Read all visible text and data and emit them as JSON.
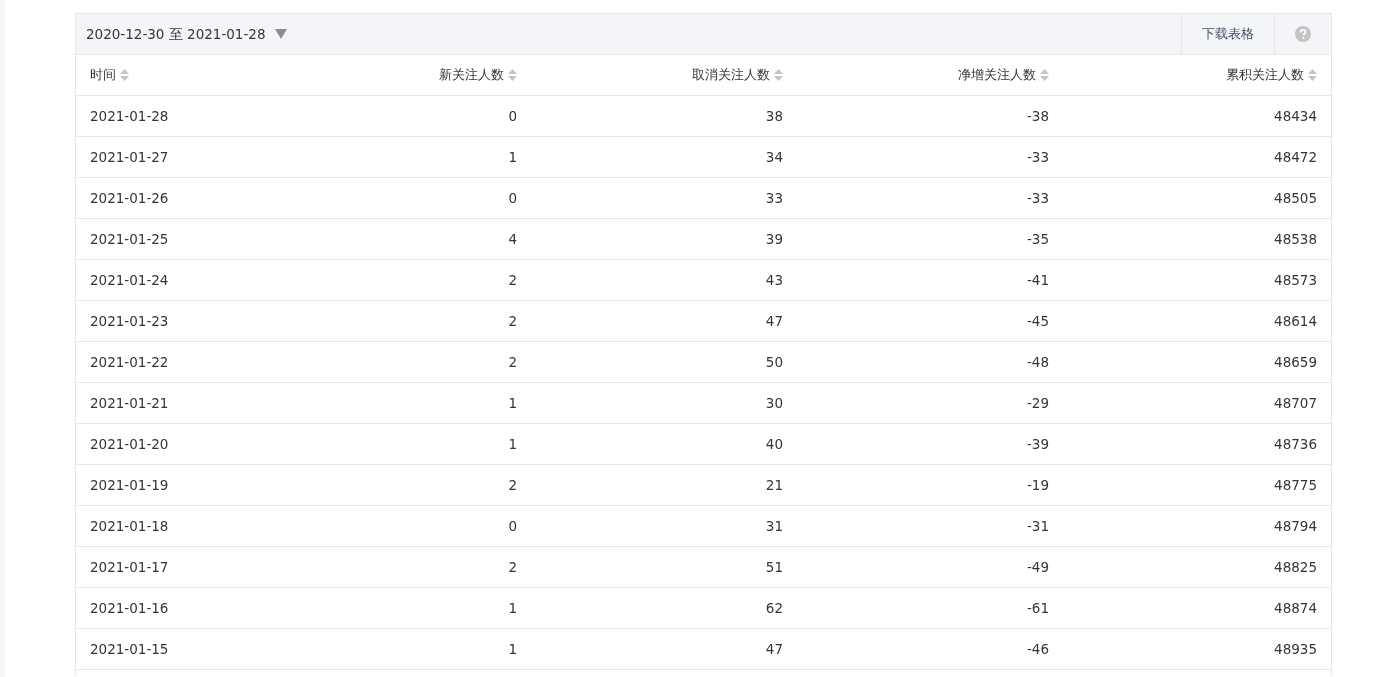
{
  "toolbar": {
    "date_range": "2020-12-30 至 2021-01-28",
    "download_button": "下载表格"
  },
  "table": {
    "columns": [
      "时间",
      "新关注人数",
      "取消关注人数",
      "净增关注人数",
      "累积关注人数"
    ],
    "rows": [
      [
        "2021-01-28",
        "0",
        "38",
        "-38",
        "48434"
      ],
      [
        "2021-01-27",
        "1",
        "34",
        "-33",
        "48472"
      ],
      [
        "2021-01-26",
        "0",
        "33",
        "-33",
        "48505"
      ],
      [
        "2021-01-25",
        "4",
        "39",
        "-35",
        "48538"
      ],
      [
        "2021-01-24",
        "2",
        "43",
        "-41",
        "48573"
      ],
      [
        "2021-01-23",
        "2",
        "47",
        "-45",
        "48614"
      ],
      [
        "2021-01-22",
        "2",
        "50",
        "-48",
        "48659"
      ],
      [
        "2021-01-21",
        "1",
        "30",
        "-29",
        "48707"
      ],
      [
        "2021-01-20",
        "1",
        "40",
        "-39",
        "48736"
      ],
      [
        "2021-01-19",
        "2",
        "21",
        "-19",
        "48775"
      ],
      [
        "2021-01-18",
        "0",
        "31",
        "-31",
        "48794"
      ],
      [
        "2021-01-17",
        "2",
        "51",
        "-49",
        "48825"
      ],
      [
        "2021-01-16",
        "1",
        "62",
        "-61",
        "48874"
      ],
      [
        "2021-01-15",
        "1",
        "47",
        "-46",
        "48935"
      ]
    ]
  }
}
